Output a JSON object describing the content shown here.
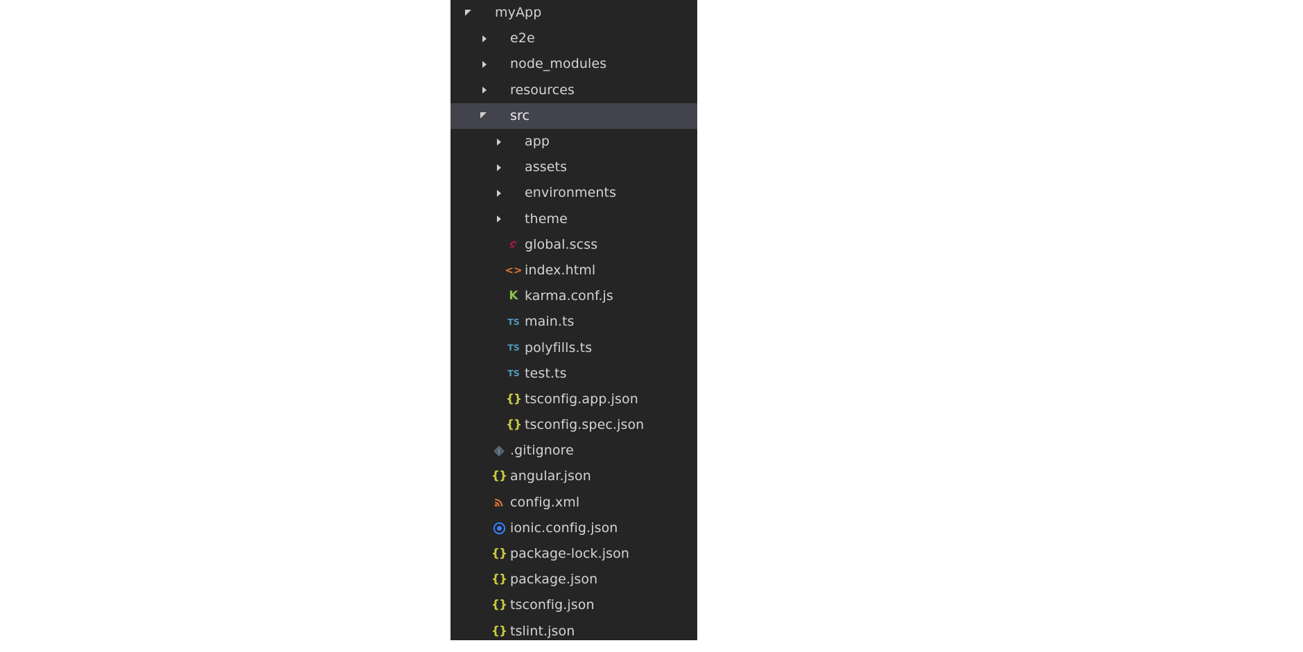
{
  "panel": {
    "name": "file-explorer-tree",
    "background_color": "#252526",
    "selected_row_color": "#43434d",
    "text_color": "#d4d4d4"
  },
  "icon_colors": {
    "json": "#cbcb41",
    "typescript": "#519aba",
    "html": "#e37933",
    "scss": "#c2185b",
    "karma": "#8dc149",
    "git": "#41535b",
    "xml": "#e37933",
    "ionic": "#3880ff"
  },
  "tree": {
    "items": [
      {
        "label": "myApp",
        "depth": 0,
        "kind": "folder",
        "state": "expanded",
        "icon": "none",
        "selected": false
      },
      {
        "label": "e2e",
        "depth": 1,
        "kind": "folder",
        "state": "collapsed",
        "icon": "none",
        "selected": false
      },
      {
        "label": "node_modules",
        "depth": 1,
        "kind": "folder",
        "state": "collapsed",
        "icon": "none",
        "selected": false
      },
      {
        "label": "resources",
        "depth": 1,
        "kind": "folder",
        "state": "collapsed",
        "icon": "none",
        "selected": false
      },
      {
        "label": "src",
        "depth": 1,
        "kind": "folder",
        "state": "expanded",
        "icon": "none",
        "selected": true
      },
      {
        "label": "app",
        "depth": 2,
        "kind": "folder",
        "state": "collapsed",
        "icon": "none",
        "selected": false
      },
      {
        "label": "assets",
        "depth": 2,
        "kind": "folder",
        "state": "collapsed",
        "icon": "none",
        "selected": false
      },
      {
        "label": "environments",
        "depth": 2,
        "kind": "folder",
        "state": "collapsed",
        "icon": "none",
        "selected": false
      },
      {
        "label": "theme",
        "depth": 2,
        "kind": "folder",
        "state": "collapsed",
        "icon": "none",
        "selected": false
      },
      {
        "label": "global.scss",
        "depth": 2,
        "kind": "file",
        "state": "none",
        "icon": "scss",
        "selected": false
      },
      {
        "label": "index.html",
        "depth": 2,
        "kind": "file",
        "state": "none",
        "icon": "html",
        "selected": false
      },
      {
        "label": "karma.conf.js",
        "depth": 2,
        "kind": "file",
        "state": "none",
        "icon": "karma",
        "selected": false
      },
      {
        "label": "main.ts",
        "depth": 2,
        "kind": "file",
        "state": "none",
        "icon": "ts",
        "selected": false
      },
      {
        "label": "polyfills.ts",
        "depth": 2,
        "kind": "file",
        "state": "none",
        "icon": "ts",
        "selected": false
      },
      {
        "label": "test.ts",
        "depth": 2,
        "kind": "file",
        "state": "none",
        "icon": "ts",
        "selected": false
      },
      {
        "label": "tsconfig.app.json",
        "depth": 2,
        "kind": "file",
        "state": "none",
        "icon": "json",
        "selected": false
      },
      {
        "label": "tsconfig.spec.json",
        "depth": 2,
        "kind": "file",
        "state": "none",
        "icon": "json",
        "selected": false
      },
      {
        "label": ".gitignore",
        "depth": 1,
        "kind": "file",
        "state": "none",
        "icon": "git",
        "selected": false
      },
      {
        "label": "angular.json",
        "depth": 1,
        "kind": "file",
        "state": "none",
        "icon": "json",
        "selected": false
      },
      {
        "label": "config.xml",
        "depth": 1,
        "kind": "file",
        "state": "none",
        "icon": "xml",
        "selected": false
      },
      {
        "label": "ionic.config.json",
        "depth": 1,
        "kind": "file",
        "state": "none",
        "icon": "ionic",
        "selected": false
      },
      {
        "label": "package-lock.json",
        "depth": 1,
        "kind": "file",
        "state": "none",
        "icon": "json",
        "selected": false
      },
      {
        "label": "package.json",
        "depth": 1,
        "kind": "file",
        "state": "none",
        "icon": "json",
        "selected": false
      },
      {
        "label": "tsconfig.json",
        "depth": 1,
        "kind": "file",
        "state": "none",
        "icon": "json",
        "selected": false
      },
      {
        "label": "tslint.json",
        "depth": 1,
        "kind": "file",
        "state": "none",
        "icon": "json",
        "selected": false
      }
    ],
    "icon_glyphs": {
      "json": "{}",
      "ts": "TS",
      "html": "<>",
      "karma": "K"
    }
  }
}
